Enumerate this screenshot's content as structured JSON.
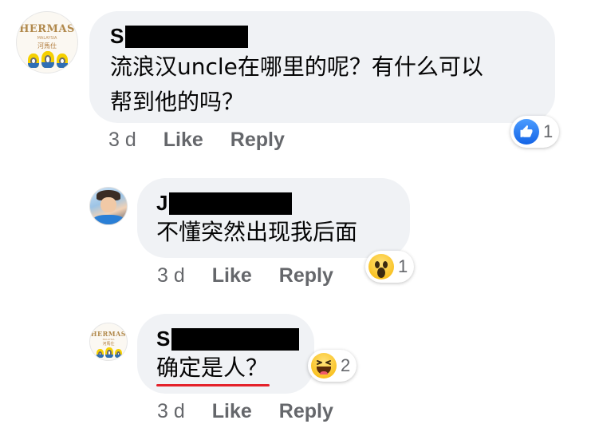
{
  "comments": [
    {
      "author_initial": "S",
      "text_lines": [
        "流浪汉uncle在哪里的呢？有什么可以",
        "帮到他的吗？"
      ],
      "time": "3 d",
      "actions": [
        "Like",
        "Reply"
      ],
      "reaction": {
        "icon": "like-icon",
        "count": "1"
      },
      "avatar": {
        "brand": "HERMAS",
        "sub": "MALAYSIA",
        "cn": "河馬仕"
      }
    },
    {
      "author_initial": "J",
      "text_lines": [
        "不懂突然出现我后面"
      ],
      "time": "3 d",
      "actions": [
        "Like",
        "Reply"
      ],
      "reaction": {
        "icon": "wow-icon",
        "count": "1"
      },
      "avatar": {
        "kind": "photo"
      }
    },
    {
      "author_initial": "S",
      "text_lines": [
        "确定是人？"
      ],
      "time": "3 d",
      "actions": [
        "Like",
        "Reply"
      ],
      "reaction": {
        "icon": "haha-icon",
        "count": "2"
      },
      "avatar": {
        "brand": "HERMAS",
        "sub": "MALAYSIA",
        "cn": "河馬仕"
      }
    }
  ],
  "colors": {
    "bubble": "#f0f2f5",
    "meta_text": "#65676b",
    "like_blue": "#1877f2",
    "underline_red": "#e4212a"
  }
}
